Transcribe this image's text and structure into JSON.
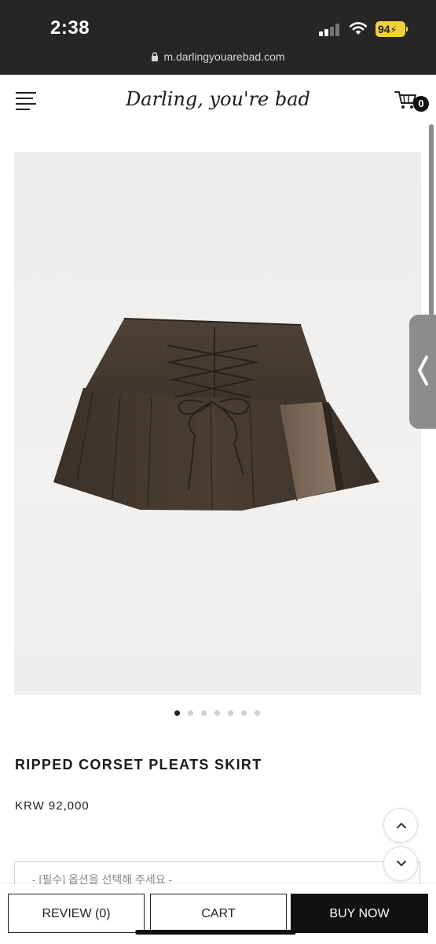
{
  "status_bar": {
    "time": "2:38",
    "battery": "94",
    "url": "m.darlingyouarebad.com"
  },
  "header": {
    "brand": "Darling, you're bad",
    "cart_count": "0"
  },
  "gallery": {
    "image_count": 7,
    "active_index": 0,
    "skirt_color": "#4a3d33"
  },
  "product": {
    "title": "RIPPED CORSET PLEATS SKIRT",
    "price": "KRW 92,000",
    "option_placeholder": "- [필수] 옵션을 선택해 주세요 -"
  },
  "actions": {
    "review_label": "REVIEW (0)",
    "cart_label": "CART",
    "buy_label": "BUY NOW"
  },
  "icons": {
    "menu": "hamburger-menu-icon",
    "cart": "shopping-cart-icon",
    "lock": "lock-icon",
    "scroll_up": "chevron-up-icon",
    "scroll_down": "chevron-down-icon",
    "side_tab": "chevron-left-icon"
  }
}
